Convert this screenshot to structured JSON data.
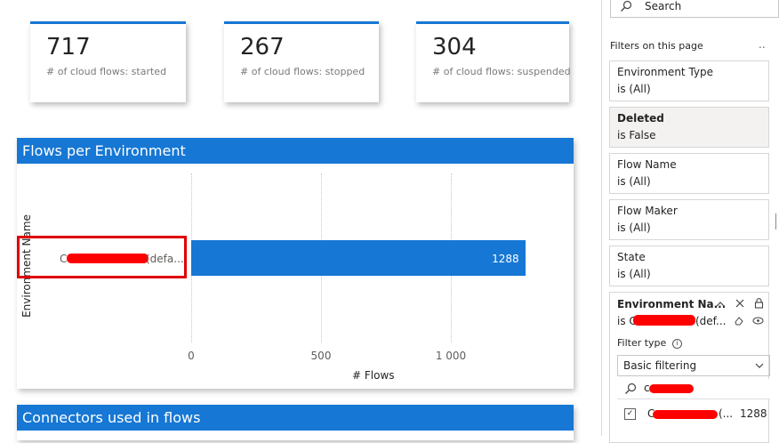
{
  "kpis": [
    {
      "value": "717",
      "label": "# of cloud flows: started"
    },
    {
      "value": "267",
      "label": "# of cloud flows: stopped"
    },
    {
      "value": "304",
      "label": "# of cloud flows: suspended"
    }
  ],
  "flows_chart": {
    "title": "Flows per Environment",
    "chart_data": {
      "type": "bar",
      "orientation": "horizontal",
      "categories": [
        "C•••••••• (defa..."
      ],
      "category_prefix": "C",
      "category_suffix": "(defa...",
      "values": [
        1288
      ],
      "value_label": "1288",
      "xlabel": "# Flows",
      "ylabel": "Environment Name",
      "xlim": [
        0,
        1500
      ],
      "ticks": [
        0,
        500,
        1000
      ],
      "tick_labels": [
        "0",
        "500",
        "1 000"
      ],
      "bar_color": "#1677d4",
      "grid": true
    }
  },
  "connectors_chart": {
    "title": "Connectors used in flows"
  },
  "filters": {
    "search_placeholder": "Search",
    "header": "Filters on this page",
    "more": "..",
    "cards": [
      {
        "title": "Environment Type",
        "value": "is (All)"
      },
      {
        "title": "Deleted",
        "value": "is False"
      },
      {
        "title": "Flow Name",
        "value": "is (All)"
      },
      {
        "title": "Flow Maker",
        "value": "is (All)"
      },
      {
        "title": "State",
        "value": "is (All)"
      }
    ],
    "expanded": {
      "title": "Environment Na...",
      "value_prefix": "is C",
      "value_suffix": "(def...",
      "filter_type_label": "Filter type",
      "filter_type_value": "Basic filtering",
      "search_text": "c",
      "item_prefix": "C",
      "item_suffix": "(...",
      "item_count": "1288"
    }
  },
  "colors": {
    "accent": "#1677d4",
    "redaction": "#ff0000",
    "highlight_box": "#e00000"
  }
}
